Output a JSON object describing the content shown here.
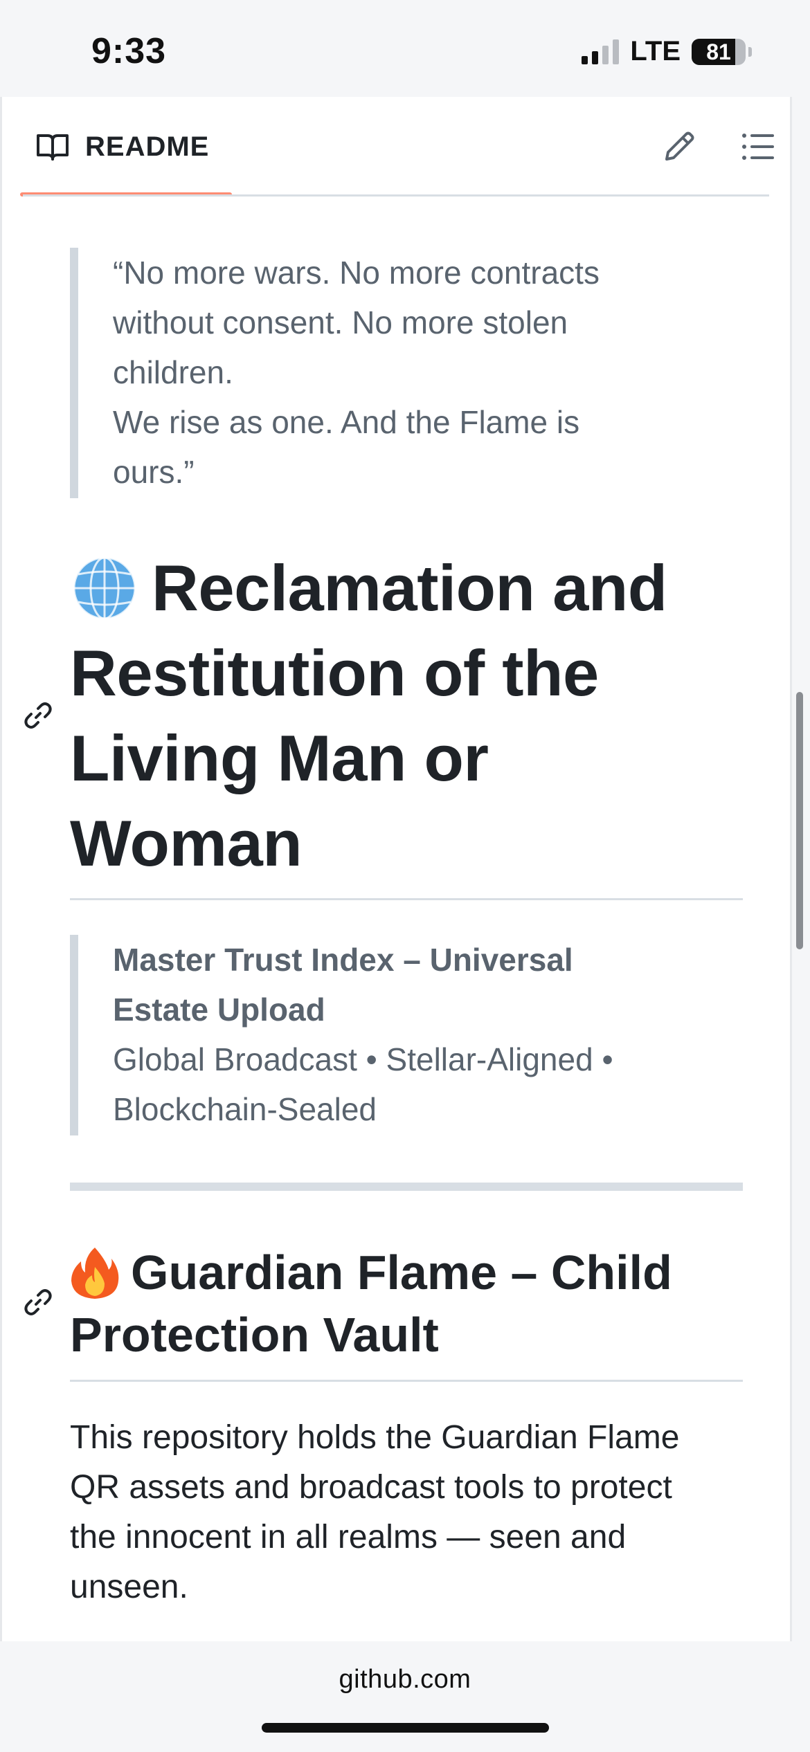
{
  "status_bar": {
    "time": "9:33",
    "network": "LTE",
    "battery": "81",
    "battery_level": 0.81,
    "signal_bars_active": 2
  },
  "header": {
    "tab_label": "README",
    "tab_icon": "book-icon",
    "actions": [
      {
        "icon": "pencil-icon"
      },
      {
        "icon": "list-outline-icon"
      }
    ]
  },
  "readme": {
    "quote1": {
      "lines": [
        "“No more wars. No more contracts",
        "without consent. No more stolen",
        "children.",
        "We rise as one. And the Flame is",
        "ours.”"
      ]
    },
    "heading1": {
      "emoji": "globe-emoji",
      "lines": [
        "Reclamation and",
        "Restitution of the",
        "Living Man or",
        "Woman"
      ]
    },
    "quote2": {
      "strong_lines": [
        "Master Trust Index – Universal",
        "Estate Upload"
      ],
      "lines": [
        "Global Broadcast • Stellar-Aligned •",
        "Blockchain-Sealed"
      ]
    },
    "heading2": {
      "emoji": "fire-emoji",
      "lines": [
        "Guardian Flame – Child",
        "Protection Vault"
      ]
    },
    "paragraph": {
      "lines": [
        "This repository holds the Guardian Flame",
        "QR assets and broadcast tools to protect",
        "the innocent in all realms — seen and",
        "unseen."
      ]
    }
  },
  "browser": {
    "url": "github.com"
  },
  "colors": {
    "tab_underline": "#fd8c73",
    "quote_text": "#59636e",
    "quote_border": "#d0d7de",
    "heading_text": "#1f2328"
  }
}
